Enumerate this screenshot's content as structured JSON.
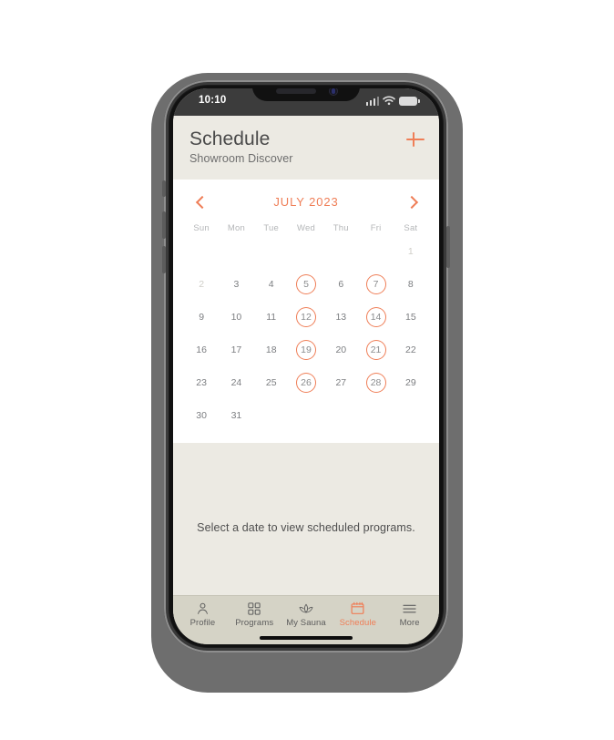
{
  "status_bar": {
    "time": "10:10",
    "signal_icon": "cellular-bars-icon",
    "wifi_icon": "wifi-icon",
    "battery_icon": "battery-icon"
  },
  "header": {
    "title": "Schedule",
    "subtitle": "Showroom Discover",
    "add_icon": "plus-icon",
    "accent_color": "#ef7e57"
  },
  "calendar": {
    "month_label": "JULY 2023",
    "prev_icon": "chevron-left-icon",
    "next_icon": "chevron-right-icon",
    "weekdays": [
      "Sun",
      "Mon",
      "Tue",
      "Wed",
      "Thu",
      "Fri",
      "Sat"
    ],
    "weeks": [
      [
        {
          "label": "",
          "state": "empty"
        },
        {
          "label": "",
          "state": "empty"
        },
        {
          "label": "",
          "state": "empty"
        },
        {
          "label": "",
          "state": "empty"
        },
        {
          "label": "",
          "state": "empty"
        },
        {
          "label": "",
          "state": "empty"
        },
        {
          "label": "1",
          "state": "muted"
        }
      ],
      [
        {
          "label": "2",
          "state": "muted"
        },
        {
          "label": "3",
          "state": "normal"
        },
        {
          "label": "4",
          "state": "normal"
        },
        {
          "label": "5",
          "state": "marked"
        },
        {
          "label": "6",
          "state": "normal"
        },
        {
          "label": "7",
          "state": "marked"
        },
        {
          "label": "8",
          "state": "normal"
        }
      ],
      [
        {
          "label": "9",
          "state": "normal"
        },
        {
          "label": "10",
          "state": "normal"
        },
        {
          "label": "11",
          "state": "normal"
        },
        {
          "label": "12",
          "state": "marked"
        },
        {
          "label": "13",
          "state": "normal"
        },
        {
          "label": "14",
          "state": "marked"
        },
        {
          "label": "15",
          "state": "normal"
        }
      ],
      [
        {
          "label": "16",
          "state": "normal"
        },
        {
          "label": "17",
          "state": "normal"
        },
        {
          "label": "18",
          "state": "normal"
        },
        {
          "label": "19",
          "state": "marked"
        },
        {
          "label": "20",
          "state": "normal"
        },
        {
          "label": "21",
          "state": "marked"
        },
        {
          "label": "22",
          "state": "normal"
        }
      ],
      [
        {
          "label": "23",
          "state": "normal"
        },
        {
          "label": "24",
          "state": "normal"
        },
        {
          "label": "25",
          "state": "normal"
        },
        {
          "label": "26",
          "state": "marked"
        },
        {
          "label": "27",
          "state": "normal"
        },
        {
          "label": "28",
          "state": "marked"
        },
        {
          "label": "29",
          "state": "normal"
        }
      ],
      [
        {
          "label": "30",
          "state": "normal"
        },
        {
          "label": "31",
          "state": "normal"
        },
        {
          "label": "",
          "state": "empty"
        },
        {
          "label": "",
          "state": "empty"
        },
        {
          "label": "",
          "state": "empty"
        },
        {
          "label": "",
          "state": "empty"
        },
        {
          "label": "",
          "state": "empty"
        }
      ]
    ]
  },
  "content": {
    "empty_message": "Select a date to view scheduled programs."
  },
  "tabbar": {
    "items": [
      {
        "label": "Profile",
        "icon": "person-icon",
        "active": false
      },
      {
        "label": "Programs",
        "icon": "grid-icon",
        "active": false
      },
      {
        "label": "My Sauna",
        "icon": "lotus-icon",
        "active": false
      },
      {
        "label": "Schedule",
        "icon": "calendar-icon",
        "active": true
      },
      {
        "label": "More",
        "icon": "menu-icon",
        "active": false
      }
    ],
    "active_color": "#ef7e57",
    "inactive_color": "#5d5d5d"
  }
}
